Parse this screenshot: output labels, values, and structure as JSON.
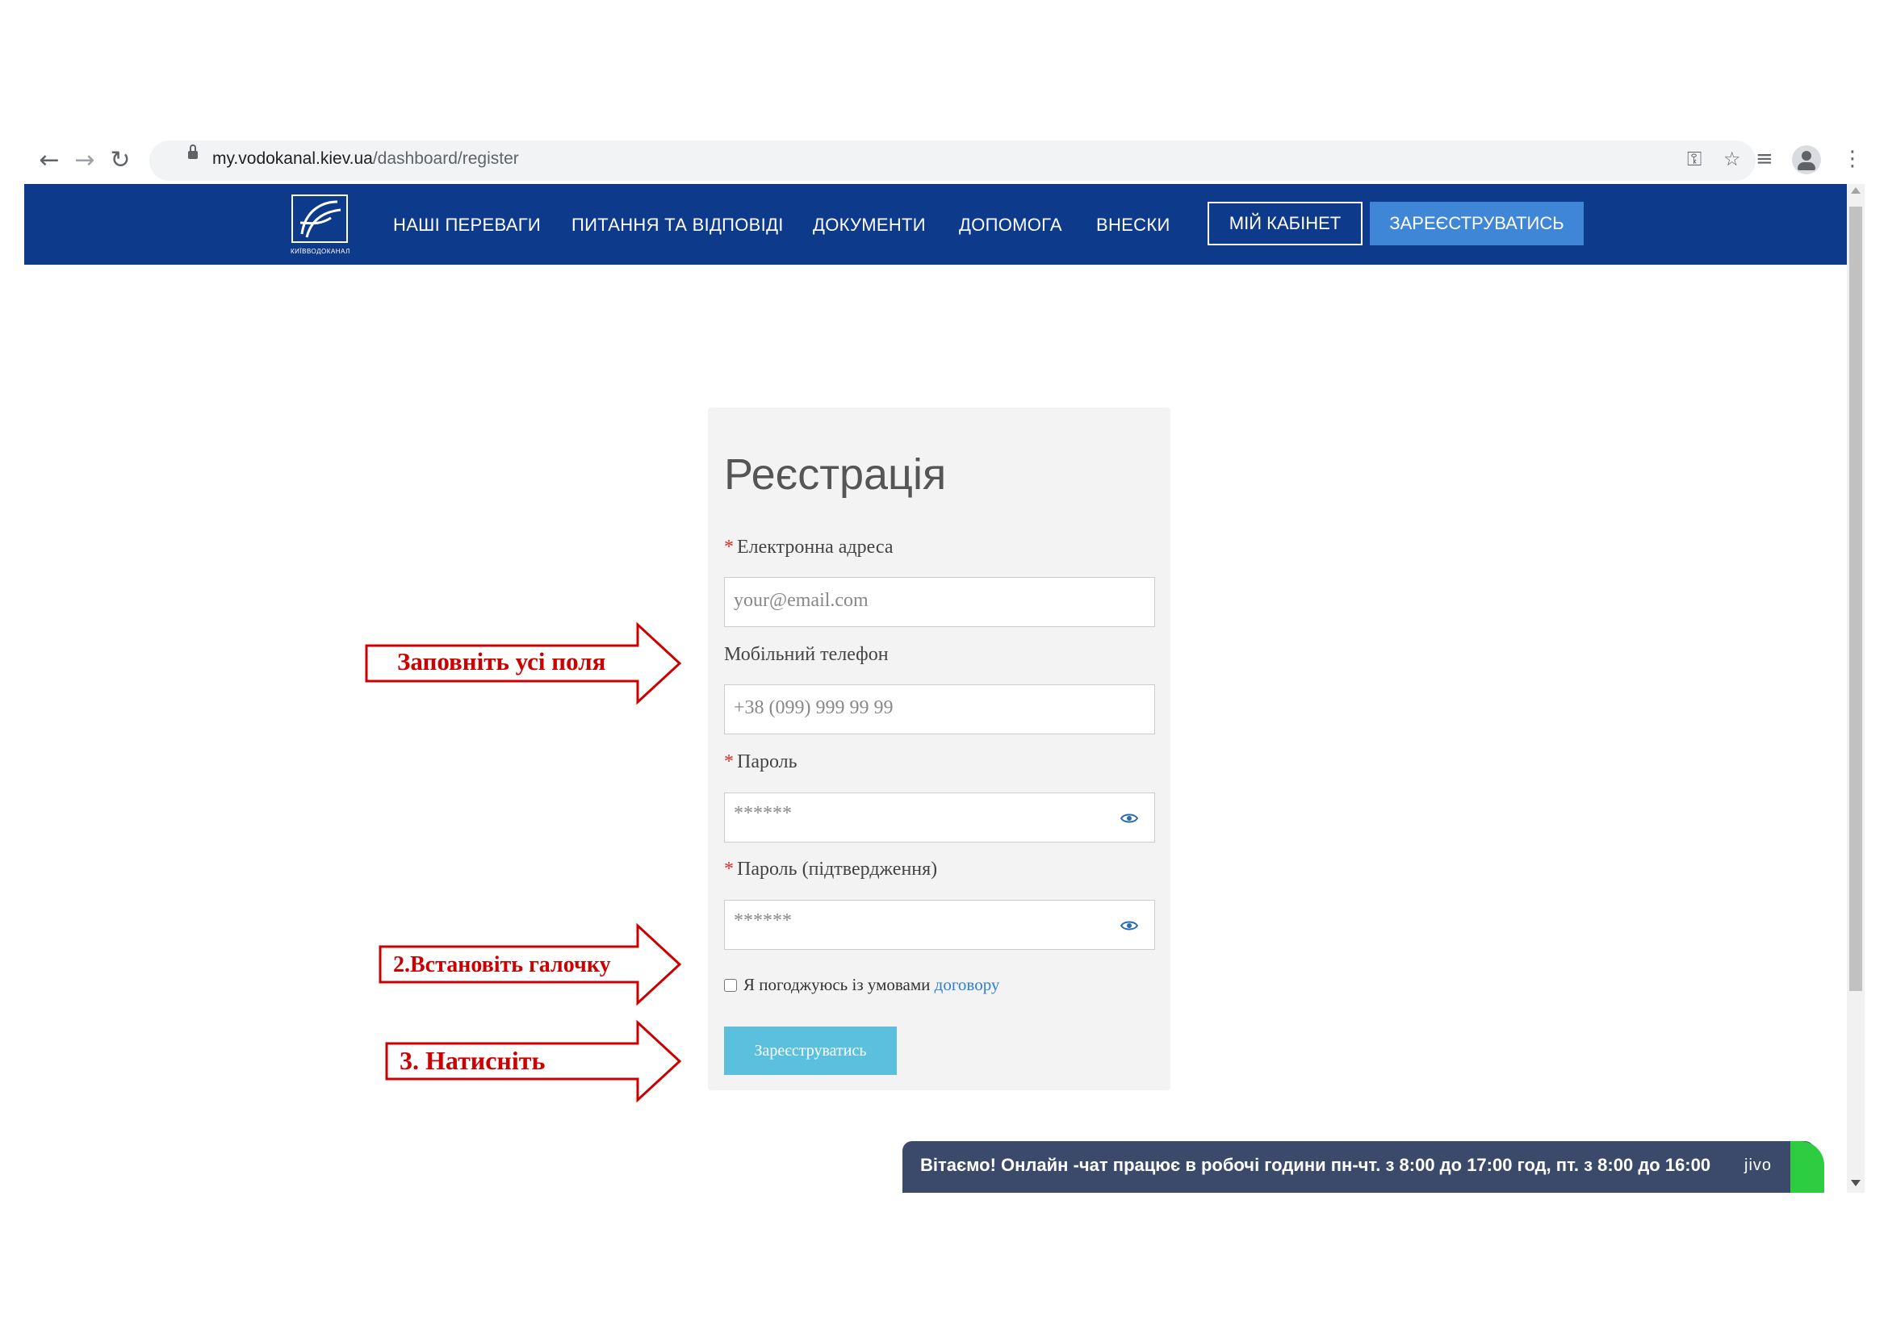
{
  "browser": {
    "url_host": "my.vodokanal.kiev.ua",
    "url_path": "/dashboard/register"
  },
  "site": {
    "logo_text": "КИЇВВОДОКАНАЛ",
    "nav": [
      {
        "label": "НАШІ ПЕРЕВАГИ"
      },
      {
        "label": "ПИТАННЯ ТА ВІДПОВІДІ"
      },
      {
        "label": "ДОКУМЕНТИ"
      },
      {
        "label": "ДОПОМОГА"
      },
      {
        "label": "ВНЕСКИ"
      }
    ],
    "cabinet_label": "МІЙ КАБІНЕТ",
    "register_label": "ЗАРЕЄСТРУВАТИСЬ"
  },
  "form": {
    "title": "Реєстрація",
    "email_label": "Електронна адреса",
    "email_placeholder": "your@email.com",
    "phone_label": "Мобільний телефон",
    "phone_placeholder": "+38 (099) 999 99 99",
    "password_label": "Пароль",
    "password_placeholder": "******",
    "confirm_label": "Пароль (підтвердження)",
    "confirm_placeholder": "******",
    "required_mark": "*",
    "agree_text": "Я погоджуюсь із умовами",
    "agree_link": "договору",
    "submit_label": "Зареєструватись"
  },
  "chat": {
    "message": "Вітаємо! Онлайн -чат працює в робочі години пн-чт. з 8:00 до 17:00 год, пт. з 8:00 до 16:00",
    "brand": "jivo"
  },
  "annotations": {
    "step1": "Заповніть усі поля",
    "step2": "2.Встановіть галочку",
    "step3": "3. Натисніть"
  },
  "colors": {
    "header_bg": "#0e3a8c",
    "register_btn": "#3f86d6",
    "submit_btn": "#5bc0de",
    "annotation": "#cc0000",
    "chat_bg": "#3b4a6b"
  }
}
